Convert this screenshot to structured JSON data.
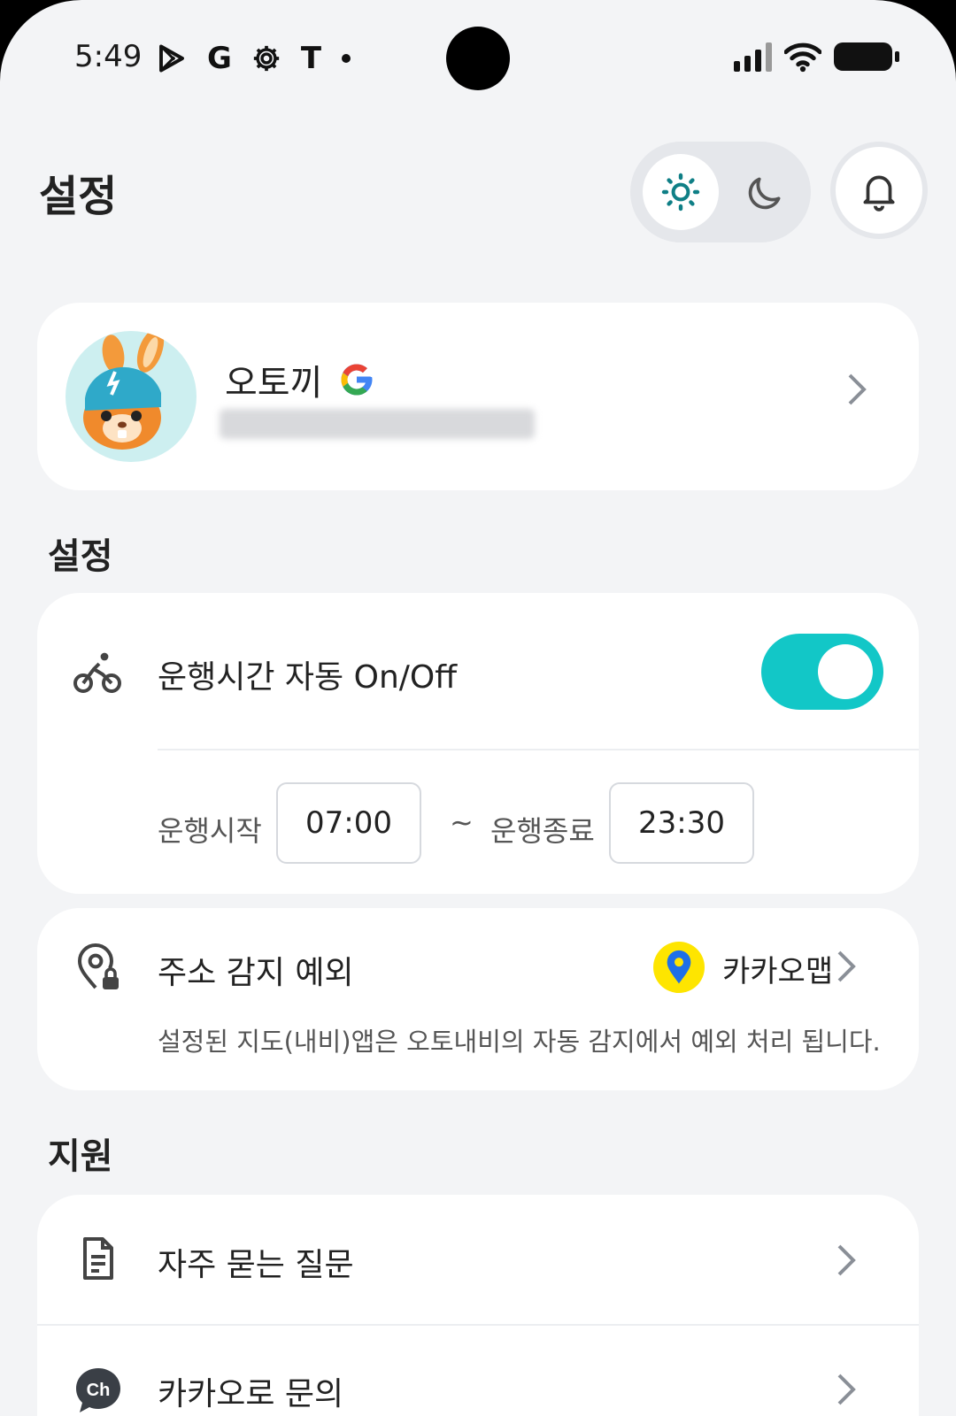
{
  "status_bar": {
    "time": "5:49",
    "left_icons": [
      "play-store-icon",
      "google-icon",
      "settings-gear-icon",
      "t-app-icon",
      "notification-dot-icon"
    ],
    "right_icons": [
      "signal-icon",
      "wifi-icon",
      "battery-icon"
    ]
  },
  "header": {
    "title": "설정",
    "theme_options": [
      "sun-icon",
      "moon-icon"
    ],
    "active_theme": "light",
    "bell_icon": "bell-icon"
  },
  "profile": {
    "name": "오토끼",
    "login_provider_logo": "G",
    "email_blurred": true
  },
  "settings_section": {
    "title": "설정",
    "auto_toggle": {
      "label": "운행시간 자동 On/Off",
      "enabled": true
    },
    "start_label": "운행시작",
    "start_time": "07:00",
    "separator": "~",
    "end_label": "운행종료",
    "end_time": "23:30"
  },
  "address_exception": {
    "label": "주소 감지 예외",
    "map_app": "카카오맵",
    "description": "설정된 지도(내비)앱은 오토내비의 자동 감지에서 예외 처리 됩니다."
  },
  "support_section": {
    "title": "지원",
    "items": [
      {
        "label": "자주 묻는 질문",
        "icon": "document-icon"
      },
      {
        "label": "카카오로 문의",
        "icon": "kakao-channel-icon",
        "icon_text": "Ch"
      }
    ]
  },
  "colors": {
    "accent": "#12C7C7",
    "background": "#F3F4F6",
    "kakao_yellow": "#FEE500",
    "map_pin": "#1E6FE8"
  }
}
